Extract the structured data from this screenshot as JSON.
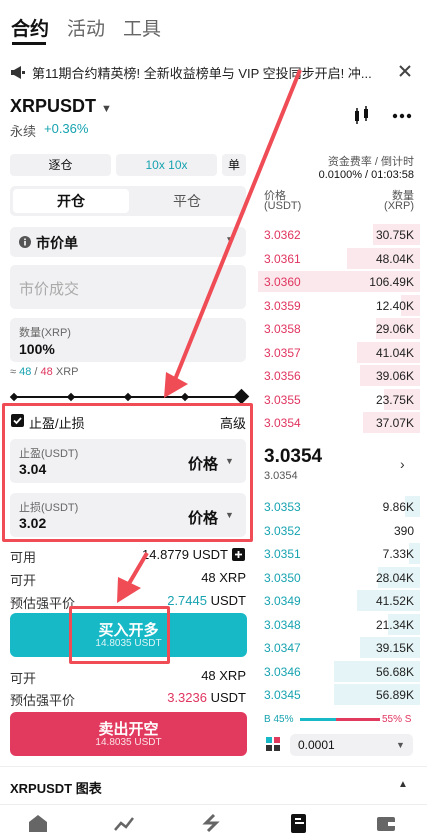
{
  "tabs": [
    "合约",
    "活动",
    "工具"
  ],
  "banner": {
    "text": "第11期合约精英榜! 全新收益榜单与 VIP 空投同步开启! 冲..."
  },
  "header": {
    "pair": "XRPUSDT",
    "type": "永续",
    "change": "+0.36%"
  },
  "controls": {
    "margin": "逐仓",
    "leverage": "10x 10x",
    "mode": "单"
  },
  "funding": {
    "label": "资金费率 / 倒计时",
    "value": "0.0100% / 01:03:58"
  },
  "side_tabs": {
    "open": "开仓",
    "close": "平仓"
  },
  "order_type": "市价单",
  "price_placeholder": "市价成交",
  "amount": {
    "label": "数量(XRP)",
    "value": "100%",
    "hint_prefix": "≈",
    "buy": "48",
    "sep": "/",
    "sell": "48",
    "unit": "XRP"
  },
  "tpsl": {
    "label": "止盈/止损",
    "advanced": "高级",
    "tp_label": "止盈(USDT)",
    "tp_value": "3.04",
    "sl_label": "止损(USDT)",
    "sl_value": "3.02",
    "price_word": "价格"
  },
  "stats_buy": [
    {
      "k": "可用",
      "v": "14.8779 USDT"
    },
    {
      "k": "可开",
      "v": "48 XRP"
    },
    {
      "k": "预估强平价",
      "v": "2.7445",
      "unit": "USDT"
    }
  ],
  "buy_btn": {
    "label": "买入开多",
    "sub": "14.8035 USDT"
  },
  "stats_sell": [
    {
      "k": "可开",
      "v": "48 XRP"
    },
    {
      "k": "预估强平价",
      "v": "3.3236",
      "unit": "USDT"
    }
  ],
  "sell_btn": {
    "label": "卖出开空",
    "sub": "14.8035 USDT"
  },
  "orderbook": {
    "h_price": "价格",
    "h_price_unit": "(USDT)",
    "h_qty": "数量",
    "h_qty_unit": "(XRP)",
    "asks": [
      [
        "3.0362",
        "30.75K",
        0.29
      ],
      [
        "3.0361",
        "48.04K",
        0.45
      ],
      [
        "3.0360",
        "106.49K",
        1.0
      ],
      [
        "3.0359",
        "12.40K",
        0.12
      ],
      [
        "3.0358",
        "29.06K",
        0.27
      ],
      [
        "3.0357",
        "41.04K",
        0.39
      ],
      [
        "3.0356",
        "39.06K",
        0.37
      ],
      [
        "3.0355",
        "23.75K",
        0.22
      ],
      [
        "3.0354",
        "37.07K",
        0.35
      ]
    ],
    "last": "3.0354",
    "last_sub": "3.0354",
    "bids": [
      [
        "3.0353",
        "9.86K",
        0.09
      ],
      [
        "3.0352",
        "390",
        0.0
      ],
      [
        "3.0351",
        "7.33K",
        0.07
      ],
      [
        "3.0350",
        "28.04K",
        0.26
      ],
      [
        "3.0349",
        "41.52K",
        0.39
      ],
      [
        "3.0348",
        "21.34K",
        0.2
      ],
      [
        "3.0347",
        "39.15K",
        0.37
      ],
      [
        "3.0346",
        "56.68K",
        0.53
      ],
      [
        "3.0345",
        "56.89K",
        0.53
      ]
    ],
    "ratio_b": "B 45%",
    "ratio_s": "55% S",
    "ratio": 0.45,
    "step": "0.0001"
  },
  "chart_bar": {
    "label": "XRPUSDT 图表"
  },
  "colors": {
    "buy": "#17b9c6",
    "sell": "#e23a5f",
    "annotation": "#ef4c56"
  }
}
